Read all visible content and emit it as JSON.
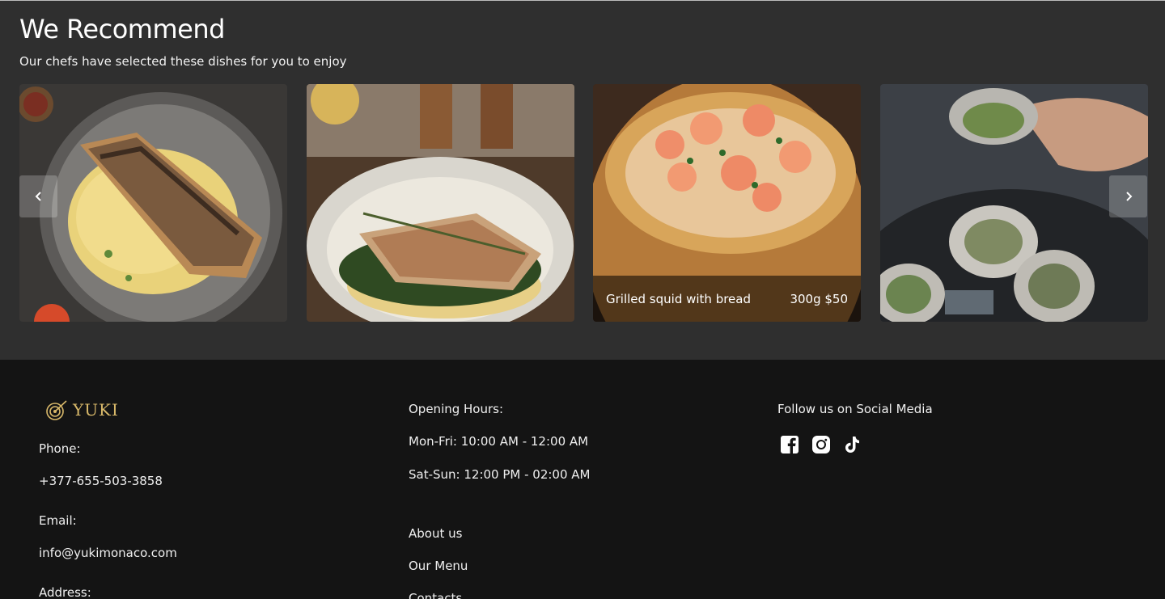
{
  "recommend": {
    "title": "We Recommend",
    "subtitle": "Our chefs have selected these dishes for you to enjoy",
    "prev_icon": "chevron-left-icon",
    "next_icon": "chevron-right-icon",
    "cards": [
      {
        "photo": "seared fish fillet on mashed potatoes"
      },
      {
        "photo": "fish fillet on spinach and potatoes"
      },
      {
        "photo": "shrimp chowder in bread bowl",
        "name": "Grilled squid with bread",
        "price": "300g $50"
      },
      {
        "photo": "oysters on ice"
      }
    ]
  },
  "footer": {
    "logo_text": "YUKI",
    "phone_label": "Phone:",
    "phone_value": "+377-655-503-3858",
    "email_label": "Email:",
    "email_value": "info@yukimonaco.com",
    "address_label": "Address:",
    "hours_label": "Opening Hours:",
    "hours_weekday": "Mon-Fri: 10:00 AM - 12:00 AM",
    "hours_weekend": "Sat-Sun: 12:00 PM - 02:00 AM",
    "links": [
      "About us",
      "Our Menu",
      "Contacts"
    ],
    "social_label": "Follow us on Social Media",
    "social_icons": [
      "facebook-icon",
      "instagram-icon",
      "tiktok-icon"
    ]
  },
  "colors": {
    "section_bg": "#2f2f2f",
    "footer_bg": "#141414",
    "logo_gold": "#d9b96a"
  }
}
